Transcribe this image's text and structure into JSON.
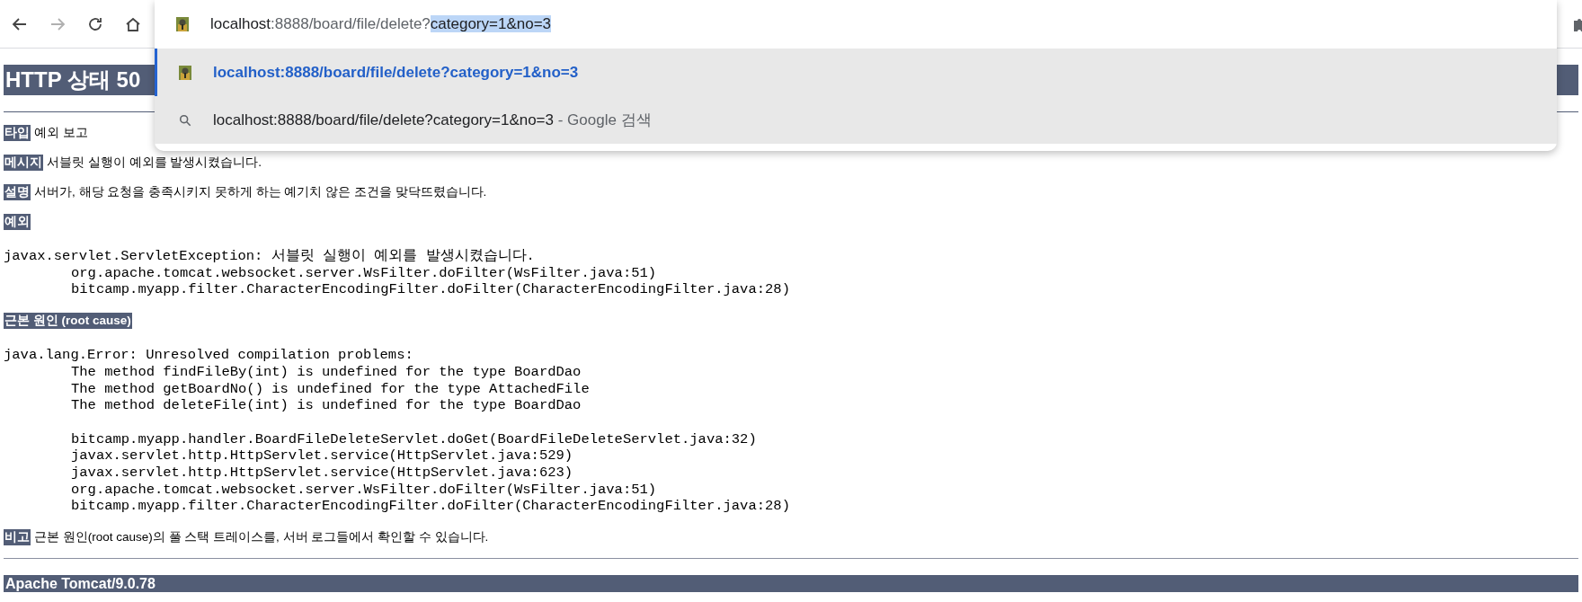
{
  "browser": {
    "toolbar": {
      "back_disabled": false,
      "forward_disabled": true
    },
    "omnibox": {
      "segments": [
        {
          "kind": "host",
          "text": "localhost"
        },
        {
          "kind": "path",
          "text": ":8888/board/file/delete?"
        },
        {
          "kind": "selected",
          "text": "category=1&no=3"
        }
      ]
    },
    "suggestions": [
      {
        "kind": "page",
        "text": "localhost:8888/board/file/delete?category=1&no=3",
        "selected": true
      },
      {
        "kind": "search",
        "text": "localhost:8888/board/file/delete?category=1&no=3",
        "suffix": " - Google 검색",
        "selected": false
      }
    ]
  },
  "page": {
    "heading": "HTTP 상태 50",
    "fields": [
      {
        "label": "타입",
        "text": "예외 보고"
      },
      {
        "label": "메시지",
        "text": "서블릿 실행이 예외를 발생시켰습니다."
      },
      {
        "label": "설명",
        "text": "서버가, 해당 요청을 충족시키지 못하게 하는 예기치 않은 조건을 맞닥뜨렸습니다."
      }
    ],
    "sections": [
      {
        "label": "예외",
        "exception": "javax.servlet.ServletException: 서블릿 실행이 예외를 발생시켰습니다.",
        "frame_groups": [
          [
            "org.apache.tomcat.websocket.server.WsFilter.doFilter(WsFilter.java:51)",
            "bitcamp.myapp.filter.CharacterEncodingFilter.doFilter(CharacterEncodingFilter.java:28)"
          ]
        ]
      },
      {
        "label": "근본 원인 (root cause)",
        "exception": "java.lang.Error: Unresolved compilation problems:",
        "frame_groups": [
          [
            "The method findFileBy(int) is undefined for the type BoardDao",
            "The method getBoardNo() is undefined for the type AttachedFile",
            "The method deleteFile(int) is undefined for the type BoardDao"
          ],
          [
            "bitcamp.myapp.handler.BoardFileDeleteServlet.doGet(BoardFileDeleteServlet.java:32)",
            "javax.servlet.http.HttpServlet.service(HttpServlet.java:529)",
            "javax.servlet.http.HttpServlet.service(HttpServlet.java:623)",
            "org.apache.tomcat.websocket.server.WsFilter.doFilter(WsFilter.java:51)",
            "bitcamp.myapp.filter.CharacterEncodingFilter.doFilter(CharacterEncodingFilter.java:28)"
          ]
        ]
      }
    ],
    "note": {
      "label": "비고",
      "text": "근본 원인(root cause)의 풀 스택 트레이스를, 서버 로그들에서 확인할 수 있습니다."
    },
    "footer": "Apache Tomcat/9.0.78"
  }
}
